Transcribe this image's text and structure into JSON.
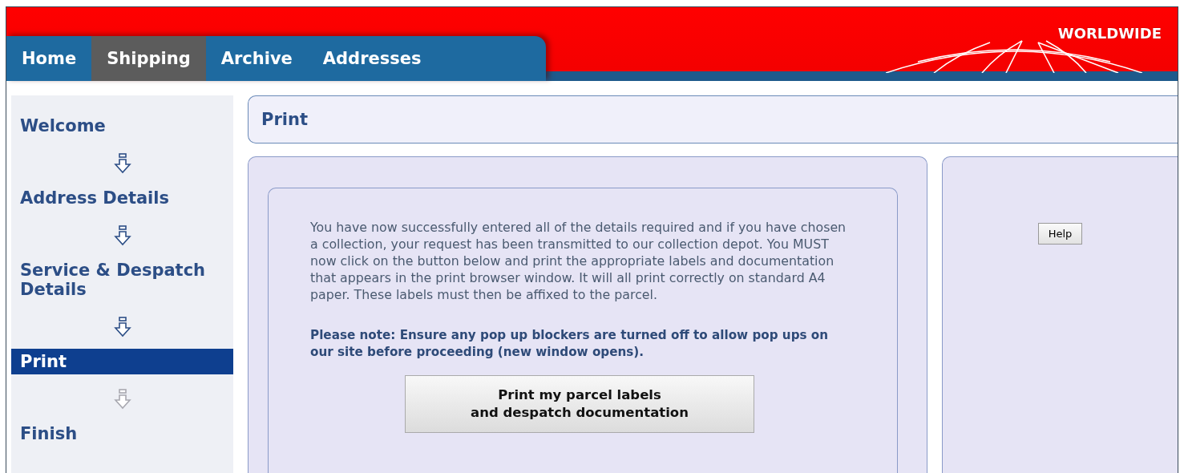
{
  "header": {
    "logo_text": "WORLDWIDE"
  },
  "tabs": [
    {
      "label": "Home",
      "selected": false
    },
    {
      "label": "Shipping",
      "selected": true
    },
    {
      "label": "Archive",
      "selected": false
    },
    {
      "label": "Addresses",
      "selected": false
    }
  ],
  "steps": [
    {
      "label": "Welcome",
      "selected": false
    },
    {
      "label": "Address Details",
      "selected": false
    },
    {
      "label": "Service & Despatch Details",
      "selected": false
    },
    {
      "label": "Print",
      "selected": true
    },
    {
      "label": "Finish",
      "selected": false
    }
  ],
  "page_title": "Print",
  "content": {
    "message": "You have now successfully entered all of the details required and if you have chosen a collection, your request has been transmitted to our collection depot. You MUST now click on the button below and print the appropriate labels and documentation that appears in the print browser window. It will all print correctly on standard A4 paper. These labels must then be affixed to the parcel.",
    "note": "Please note: Ensure any pop up blockers are turned off to allow pop ups on our site before proceeding (new window opens).",
    "print_button": "Print my parcel labels\nand despatch documentation"
  },
  "help_button": "Help"
}
